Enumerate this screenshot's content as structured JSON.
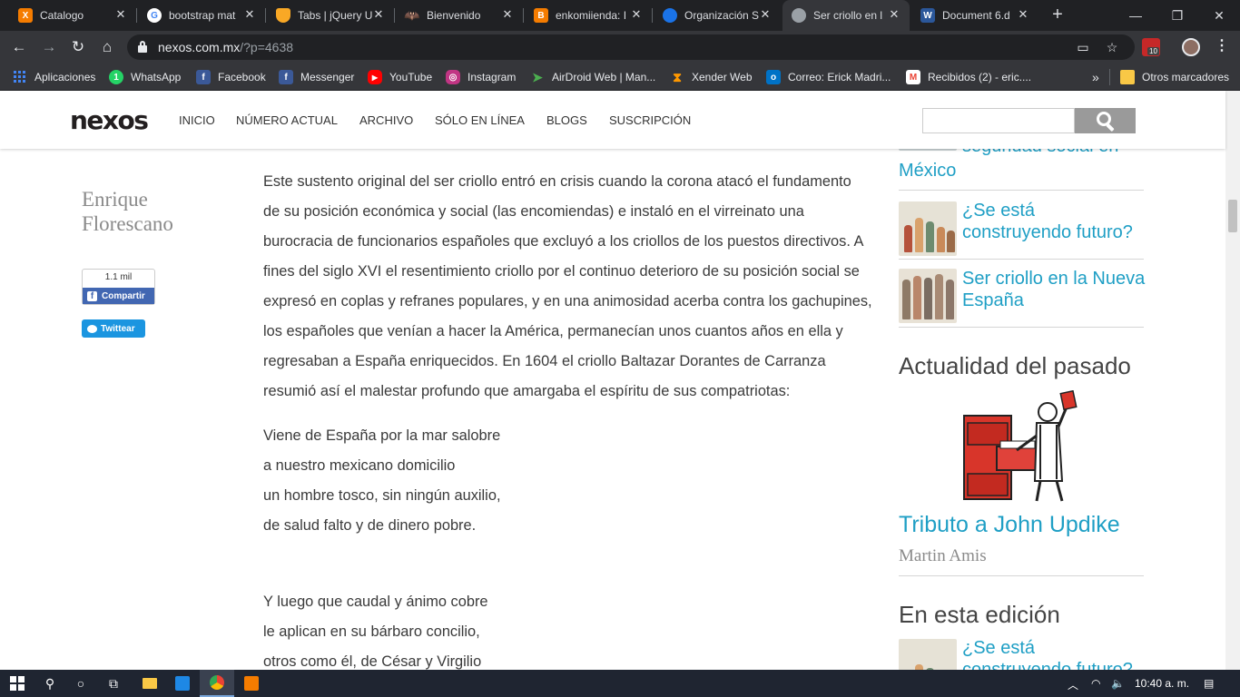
{
  "browser": {
    "tabs": [
      {
        "label": "Catalogo",
        "icon": "xampp-icon",
        "color": "#f57c00"
      },
      {
        "label": "bootstrap mat",
        "icon": "google-icon",
        "color": "#ffffff"
      },
      {
        "label": "Tabs | jQuery U",
        "icon": "shield-icon",
        "color": "#f9a825"
      },
      {
        "label": "Bienvenido",
        "icon": "batman-icon",
        "color": "#202124"
      },
      {
        "label": "enkomiienda: I",
        "icon": "blogger-icon",
        "color": "#f57c00"
      },
      {
        "label": "Organización S",
        "icon": "globe-icon",
        "color": "#1a73e8"
      },
      {
        "label": "Ser criollo en l",
        "icon": "page-icon",
        "color": "#9aa0a6"
      },
      {
        "label": "Document 6.d",
        "icon": "word-icon",
        "color": "#2b579a"
      }
    ],
    "url_host": "nexos.com.mx",
    "url_path": "/?p=4638",
    "bookmarks": [
      {
        "label": "Aplicaciones",
        "icon": "apps-grid-icon",
        "color": "#4285f4"
      },
      {
        "label": "WhatsApp",
        "icon": "whatsapp-icon",
        "color": "#25d366"
      },
      {
        "label": "Facebook",
        "icon": "facebook-icon",
        "color": "#3b5998"
      },
      {
        "label": "Messenger",
        "icon": "messenger-icon",
        "color": "#3b5998"
      },
      {
        "label": "YouTube",
        "icon": "youtube-icon",
        "color": "#ff0000"
      },
      {
        "label": "Instagram",
        "icon": "instagram-icon",
        "color": "#c13584"
      },
      {
        "label": "AirDroid Web | Man...",
        "icon": "airdroid-icon",
        "color": "#4caf50"
      },
      {
        "label": "Xender Web",
        "icon": "xender-icon",
        "color": "#ff9800"
      },
      {
        "label": "Correo: Erick Madri...",
        "icon": "outlook-icon",
        "color": "#0072c6"
      },
      {
        "label": "Recibidos (2) - eric....",
        "icon": "gmail-icon",
        "color": "#ea4335"
      }
    ],
    "other_bookmarks": "Otros marcadores",
    "overflow": "»",
    "ext_badge": "10"
  },
  "site": {
    "logo": "nexos",
    "nav": [
      "INICIO",
      "NÚMERO ACTUAL",
      "ARCHIVO",
      "SÓLO EN LÍNEA",
      "BLOGS",
      "SUSCRIPCIÓN"
    ]
  },
  "article": {
    "author_first": "Enrique",
    "author_last": "Florescano",
    "share_count": "1.1 mil",
    "share_label": "Compartir",
    "tweet_label": "Twittear",
    "paragraph_lines": [
      "Este sustento original del ser criollo entró en crisis cuando la corona atacó el fundamento",
      "de su posición económica y social (las encomiendas) e instaló en el virreinato una",
      "burocracia de funcionarios españoles que excluyó a los criollos de los puestos directivos. A",
      "fines del siglo XVI el resentimiento criollo por el continuo deterioro de su posición social se",
      "expresó en coplas y refranes populares, y en una animosidad acerba contra los gachupines,",
      "los españoles que venían a hacer la América, permanecían unos cuantos años en ella y",
      "regresaban a España enriquecidos. En 1604 el criollo Baltazar Dorantes de Carranza",
      "resumió así el malestar profundo que amargaba el espíritu de sus compatriotas:"
    ],
    "stanza1": [
      "Viene de España por la mar salobre",
      "a nuestro mexicano domicilio",
      "un hombre tosco, sin ningún auxilio,",
      "de salud falto y de dinero pobre."
    ],
    "stanza2": [
      "Y luego que caudal y ánimo cobre",
      "le aplican en su bárbaro concilio,",
      "otros como él, de César y Virgilio"
    ]
  },
  "sidebar": {
    "top_partial_line1": "seguridad social en",
    "top_partial_line2": "México",
    "link1": "¿Se está construyendo futuro?",
    "link2": "Ser criollo en la Nueva España",
    "section1": "Actualidad del pasado",
    "feature_title": "Tributo a John Updike",
    "feature_author": "Martin Amis",
    "section2": "En esta edición",
    "link3": "¿Se está construyendo futuro?"
  },
  "taskbar": {
    "time": "10:40 a. m."
  }
}
